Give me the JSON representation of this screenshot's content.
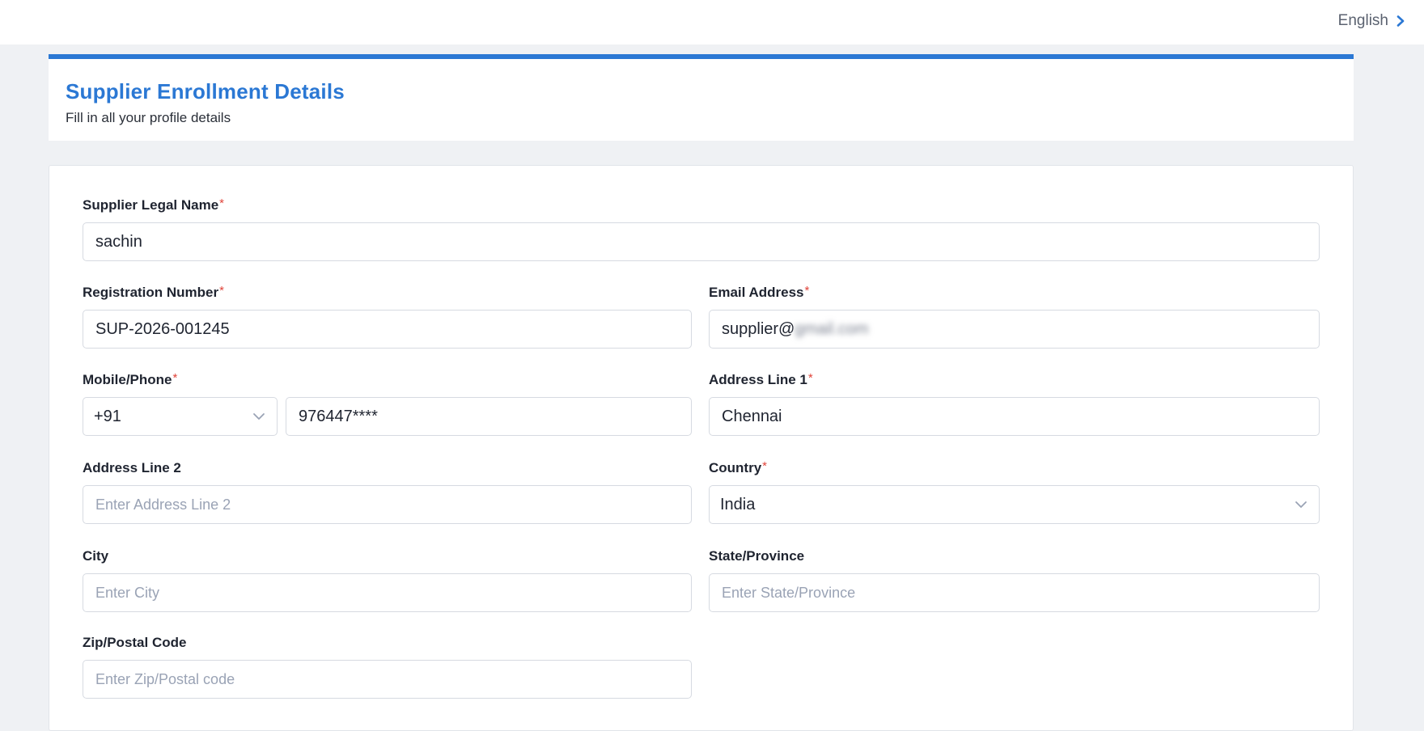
{
  "topbar": {
    "language": "English",
    "language_icon": "chevron-right-icon"
  },
  "header": {
    "title": "Supplier Enrollment Details",
    "subtitle": "Fill in all your profile details",
    "accent_color": "#2b78d4"
  },
  "form": {
    "required_marker": "*",
    "legal_name": {
      "label": "Supplier Legal Name",
      "value": "sachin"
    },
    "registration": {
      "label": "Registration Number",
      "value": "SUP-2026-001245"
    },
    "email": {
      "label": "Email Address",
      "value_visible": "supplier@",
      "value_blurred": "gmail.com"
    },
    "phone": {
      "label": "Mobile/Phone",
      "country_code": "+91",
      "number": "976447****"
    },
    "address1": {
      "label": "Address Line 1",
      "value": "Chennai"
    },
    "address2": {
      "label": "Address Line 2",
      "placeholder": "Enter Address Line 2"
    },
    "country": {
      "label": "Country",
      "value": "India"
    },
    "city": {
      "label": "City",
      "placeholder": "Enter City"
    },
    "state": {
      "label": "State/Province",
      "placeholder": "Enter State/Province"
    },
    "zip": {
      "label": "Zip/Postal Code",
      "placeholder": "Enter Zip/Postal code"
    }
  }
}
